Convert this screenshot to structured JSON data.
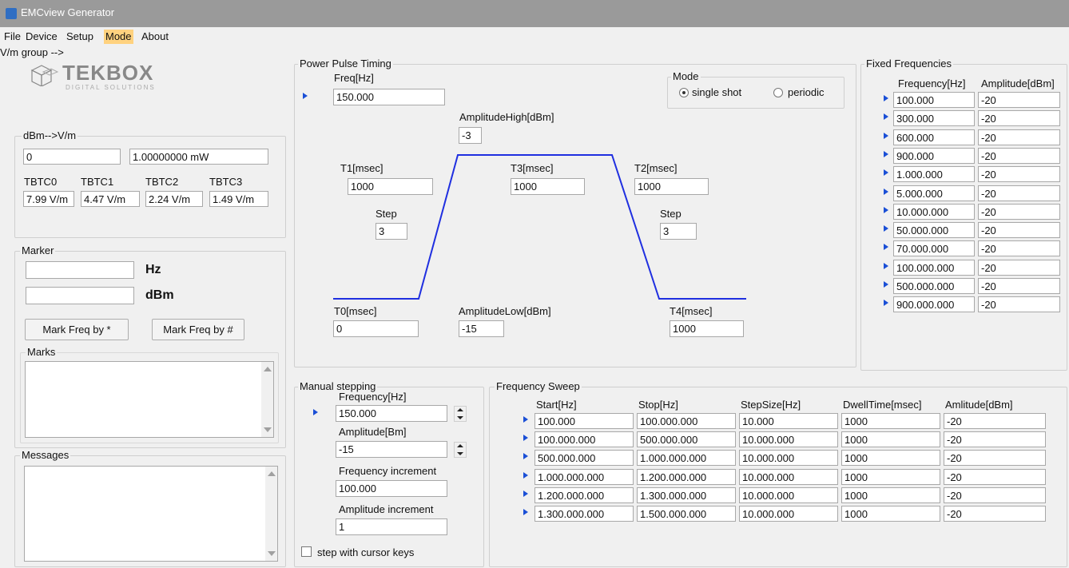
{
  "window": {
    "title": "EMCview Generator"
  },
  "menu": {
    "items": [
      "File",
      "Device",
      "Setup",
      "Mode",
      "About"
    ],
    "active": "Mode"
  },
  "logo": {
    "brand": "TEKBOX",
    "tagline": "DIGITAL SOLUTIONS"
  },
  "dbm_vm": {
    "title": "dBm-->V/m",
    "dbm_value": "0",
    "mw_value": "1.00000000 mW",
    "tbtc_labels": [
      "TBTC0",
      "TBTC1",
      "TBTC2",
      "TBTC3"
    ],
    "tbtc_values": [
      "7.99 V/m",
      "4.47 V/m",
      "2.24 V/m",
      "1.49 V/m"
    ]
  },
  "marker": {
    "title": "Marker",
    "hz_value": "",
    "hz_unit": "Hz",
    "dbm_value": "",
    "dbm_unit": "dBm",
    "btn_star": "Mark Freq by *",
    "btn_hash": "Mark Freq by #",
    "marks_title": "Marks"
  },
  "messages": {
    "title": "Messages"
  },
  "power_pulse": {
    "title": "Power Pulse Timing",
    "freq_label": "Freq[Hz]",
    "freq_value": "150.000",
    "mode_title": "Mode",
    "mode_single": "single shot",
    "mode_periodic": "periodic",
    "amp_high_label": "AmplitudeHigh[dBm]",
    "amp_high_value": "-3",
    "t1_label": "T1[msec]",
    "t1_value": "1000",
    "t3_label": "T3[msec]",
    "t3_value": "1000",
    "t2_label": "T2[msec]",
    "t2_value": "1000",
    "step_label": "Step",
    "step1_value": "3",
    "step2_value": "3",
    "t0_label": "T0[msec]",
    "t0_value": "0",
    "amp_low_label": "AmplitudeLow[dBm]",
    "amp_low_value": "-15",
    "t4_label": "T4[msec]",
    "t4_value": "1000",
    "pulse_color": "#1f2fe0"
  },
  "fixed": {
    "title": "Fixed Frequencies",
    "col_freq": "Frequency[Hz]",
    "col_amp": "Amplitude[dBm]",
    "rows": [
      {
        "f": "100.000",
        "a": "-20"
      },
      {
        "f": "300.000",
        "a": "-20"
      },
      {
        "f": "600.000",
        "a": "-20"
      },
      {
        "f": "900.000",
        "a": "-20"
      },
      {
        "f": "1.000.000",
        "a": "-20"
      },
      {
        "f": "5.000.000",
        "a": "-20"
      },
      {
        "f": "10.000.000",
        "a": "-20"
      },
      {
        "f": "50.000.000",
        "a": "-20"
      },
      {
        "f": "70.000.000",
        "a": "-20"
      },
      {
        "f": "100.000.000",
        "a": "-20"
      },
      {
        "f": "500.000.000",
        "a": "-20"
      },
      {
        "f": "900.000.000",
        "a": "-20"
      }
    ]
  },
  "manual": {
    "title": "Manual stepping",
    "freq_label": "Frequency[Hz]",
    "freq_value": "150.000",
    "amp_label": "Amplitude[Bm]",
    "amp_value": "-15",
    "finc_label": "Frequency increment",
    "finc_value": "100.000",
    "ainc_label": "Amplitude increment",
    "ainc_value": "1",
    "cursor_label": "step with cursor keys"
  },
  "sweep": {
    "title": "Frequency Sweep",
    "headers": [
      "Start[Hz]",
      "Stop[Hz]",
      "StepSize[Hz]",
      "DwellTime[msec]",
      "Amlitude[dBm]"
    ],
    "rows": [
      [
        "100.000",
        "100.000.000",
        "10.000",
        "1000",
        "-20"
      ],
      [
        "100.000.000",
        "500.000.000",
        "10.000.000",
        "1000",
        "-20"
      ],
      [
        "500.000.000",
        "1.000.000.000",
        "10.000.000",
        "1000",
        "-20"
      ],
      [
        "1.000.000.000",
        "1.200.000.000",
        "10.000.000",
        "1000",
        "-20"
      ],
      [
        "1.200.000.000",
        "1.300.000.000",
        "10.000.000",
        "1000",
        "-20"
      ],
      [
        "1.300.000.000",
        "1.500.000.000",
        "10.000.000",
        "1000",
        "-20"
      ]
    ]
  }
}
